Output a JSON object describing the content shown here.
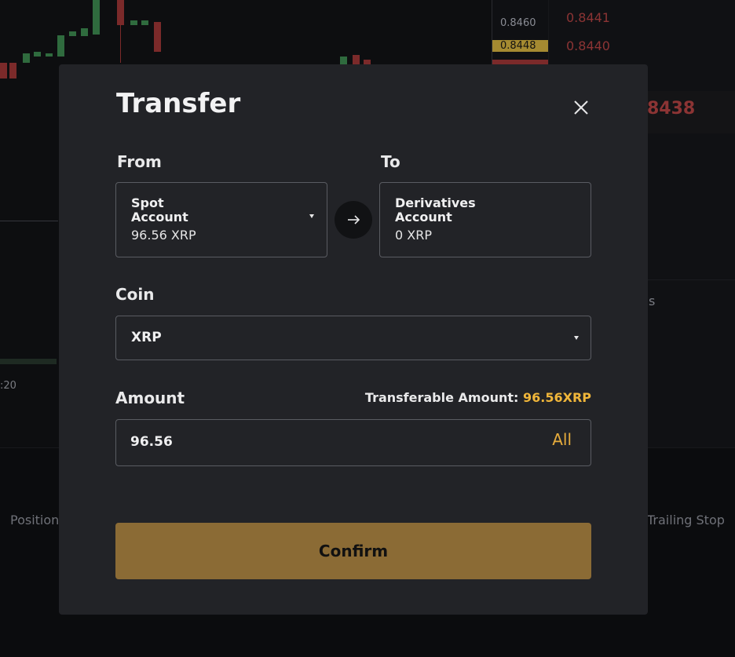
{
  "background": {
    "price_axis": [
      "0.8460",
      "0.8448"
    ],
    "orderbook_prices": [
      "0.8441",
      "0.8440"
    ],
    "orderbook_highlight": "8438",
    "orderbook_partial": "s",
    "time_label": ":20",
    "tab_left": "Position",
    "tab_right": "Trailing Stop"
  },
  "modal": {
    "title": "Transfer",
    "close_icon": "close-icon",
    "from_label": "From",
    "to_label": "To",
    "from_account": {
      "name": "Spot Account",
      "balance": "96.56 XRP"
    },
    "to_account": {
      "name": "Derivatives Account",
      "balance": "0 XRP"
    },
    "swap_icon": "arrow-right-icon",
    "coin_label": "Coin",
    "coin_value": "XRP",
    "amount_label": "Amount",
    "transferable_label": "Transferable Amount:",
    "transferable_value": "96.56XRP",
    "amount_value": "96.56",
    "all_label": "All",
    "confirm_label": "Confirm"
  },
  "colors": {
    "accent": "#f0b63a",
    "confirm_bg": "#8b6b35",
    "modal_bg": "#222327",
    "down": "#8c3434",
    "up": "#2f7a45"
  }
}
